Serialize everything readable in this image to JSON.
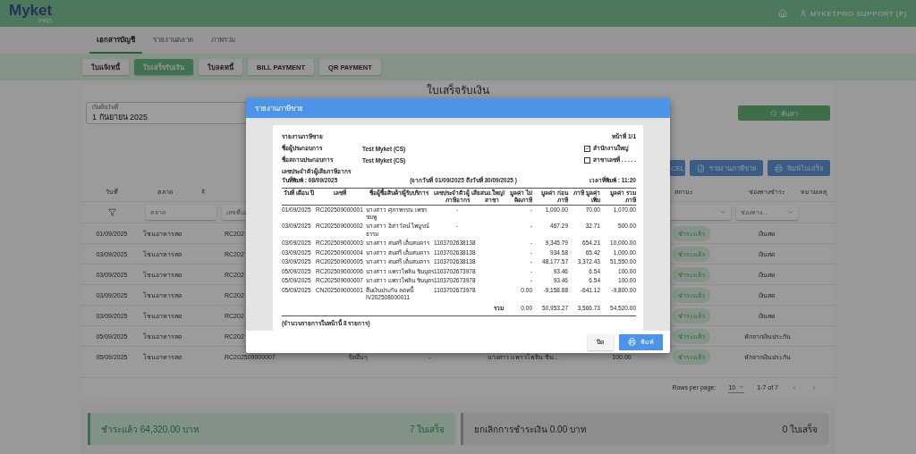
{
  "app": {
    "logo": "Myket",
    "logo_sub": "PRO",
    "user": "MYKETPRO SUPPORT (P)"
  },
  "tabs": [
    {
      "label": "เอกสารบัญชี",
      "selected": true
    },
    {
      "label": "รายงานตลาด",
      "selected": false
    },
    {
      "label": "ภาพรวม",
      "selected": false
    }
  ],
  "doc_types": [
    {
      "label": "ใบแจ้งหนี้",
      "selected": false
    },
    {
      "label": "ใบเสร็จรับเงิน",
      "selected": true
    },
    {
      "label": "ใบลดหนี้",
      "selected": false
    },
    {
      "label": "BILL PAYMENT",
      "selected": false
    },
    {
      "label": "QR PAYMENT",
      "selected": false
    }
  ],
  "page_title": "ใบเสร็จรับเงิน",
  "start_date": {
    "label": "เริ่มต้นวันที่",
    "value": "1 กันยายน 2025"
  },
  "search_button": "ค้นหา",
  "actions": [
    "CEL",
    "รายงานภาษีขาย",
    "พิมพ์ใบเสร็จ"
  ],
  "table": {
    "header": {
      "date": "วันที่",
      "market": "ตลาด",
      "status": "สถานะ",
      "payment": "ช่องทางชำระ",
      "note": "หมายเหตุ"
    },
    "filters": {
      "market": "ตลาด",
      "doc": "เลขที่เอ",
      "payment": "ช่องทาง..."
    },
    "rows": [
      {
        "date": "01/09/2025",
        "market": "โซนอาหารสด",
        "doc": "RC202",
        "status": "ชำระแล้ว",
        "payment": "เงินสด"
      },
      {
        "date": "03/09/2025",
        "market": "โซนอาหารสด",
        "doc": "RC202",
        "status": "ชำระแล้ว",
        "payment": "เงินสด"
      },
      {
        "date": "03/09/2025",
        "market": "โซนอาหารสด",
        "doc": "RC202",
        "status": "ชำระแล้ว",
        "payment": "เงินสด"
      },
      {
        "date": "03/09/2025",
        "market": "โซนอาหารสด",
        "doc": "RC202",
        "status": "ชำระแล้ว",
        "payment": "เงินสด"
      },
      {
        "date": "03/09/2025",
        "market": "โซนอาหารสด",
        "doc": "RC202",
        "status": "ชำระแล้ว",
        "payment": "เงินสด"
      },
      {
        "date": "05/09/2025",
        "market": "โซนอาหารสด",
        "doc": "RC202",
        "status": "ชำระแล้ว",
        "payment": "หักจากเงินประกัน"
      },
      {
        "date": "05/09/2025",
        "market": "โซนอาหารสด",
        "doc": "RC202509000007",
        "type": "บิลอื่นๆ",
        "ref": "-",
        "customer": "นางสาว แพรวไพลิน ชิน...",
        "amount": "100.00",
        "status": "ชำระแล้ว",
        "payment": "หักจากเงินประกัน"
      }
    ],
    "pagination": {
      "label": "Rows per page:",
      "per_page": "10",
      "range": "1-7 of 7"
    }
  },
  "summary": [
    {
      "kind": "paid",
      "label": "ชำระแล้ว 64,320.00 บาท",
      "count": "7 ใบเสร็จ"
    },
    {
      "kind": "cancelled",
      "label": "ยกเลิกการชำระเงิน 0.00 บาท",
      "count": "0 ใบเสร็จ"
    }
  ],
  "modal": {
    "title": "รายงานภาษีขาย",
    "close_button": "ปิด",
    "print_button": "พิมพ์",
    "report": {
      "title": "รายงานภาษีขาย",
      "page": "หน้าที่ 1/1",
      "info": [
        {
          "label": "ชื่อผู้ประกอบการ",
          "value": "Test Myket (CS)"
        },
        {
          "label": "ชื่อสถานประกอบการ",
          "value": "Test Myket (CS)"
        }
      ],
      "branch_options": [
        {
          "label": "สำนักงานใหญ่",
          "checked": true
        },
        {
          "label": "สาขาเลขที่ . . . . .",
          "checked": false
        }
      ],
      "tax_id_label": "เลขประจำตัวผู้เสียภาษีอากร",
      "print_date": "วันที่พิมพ์ : 08/09/2025",
      "range": "(จากวันที่ 01/09/2025 ถึงวันที่ 30/09/2025 )",
      "print_time": "เวลาที่พิมพ์ : 11:20",
      "columns": [
        "วันที่ เดือน ปี",
        "เลขที่",
        "ชื่อผู้ซื้อสินค้า/ผู้รับบริการ",
        "เลขประจำตัวผู้ เสียภาษีอากร",
        "สนง.ใหญ่/ สาขา",
        "มูลค่า ไม่คิดภาษี",
        "มูลค่า ก่อนภาษี",
        "ภาษี มูลค่าเพิ่ม",
        "มูลค่า รวมภาษี"
      ],
      "rows": [
        {
          "date": "01/09/2025",
          "no": "RC202509000001",
          "name": "นางสาว ศุภาพรรณ เพชร ชมพู",
          "tax_id": "-",
          "nonvat": "-",
          "base": "1,000.00",
          "vat": "70.00",
          "total": "1,070.00"
        },
        {
          "date": "03/09/2025",
          "no": "RC202509000002",
          "name": "นางสาว อิสาวัตน์ ไพบูรณ์ ธรรม",
          "tax_id": "-",
          "nonvat": "-",
          "base": "467.29",
          "vat": "32.71",
          "total": "500.00"
        },
        {
          "date": "03/09/2025",
          "no": "RC202509000003",
          "name": "นางสาว สมศรี เต็มสมคาร",
          "tax_id": "1103702638138",
          "nonvat": "-",
          "base": "9,345.79",
          "vat": "654.21",
          "total": "10,000.00"
        },
        {
          "date": "03/09/2025",
          "no": "RC202509000004",
          "name": "นางสาว สมศรี เต็มสมคาร",
          "tax_id": "1103702638138",
          "nonvat": "-",
          "base": "934.58",
          "vat": "65.42",
          "total": "1,000.00"
        },
        {
          "date": "03/09/2025",
          "no": "RC202509000005",
          "name": "นางสาว สมศรี เต็มสมคาร",
          "tax_id": "1103702638138",
          "nonvat": "-",
          "base": "48,177.57",
          "vat": "3,372.43",
          "total": "51,550.00"
        },
        {
          "date": "05/09/2025",
          "no": "RC202509000006",
          "name": "นางสาว แพรวไพลิน ชินบุตร",
          "tax_id": "1103702673978",
          "nonvat": "-",
          "base": "93.46",
          "vat": "6.54",
          "total": "100.00"
        },
        {
          "date": "05/09/2025",
          "no": "RC202509000007",
          "name": "นางสาว แพรวไพลิน ชินบุตร",
          "tax_id": "1103702673978",
          "nonvat": "-",
          "base": "93.46",
          "vat": "6.54",
          "total": "100.00"
        },
        {
          "date": "05/09/2025",
          "no": "CN202509000001",
          "name": "คืนเงินประกัน ลดหนี้ IV202508000011",
          "tax_id": "1103702673978",
          "nonvat": "0.00",
          "base": "-9,158.88",
          "vat": "-641.12",
          "total": "-9,800.00"
        }
      ],
      "total": {
        "label": "รวม",
        "nonvat": "0.00",
        "base": "50,953.27",
        "vat": "3,566.73",
        "total": "54,520.00"
      },
      "footer": "(จำนวนรายการในหน้านี้ 8 รายการ)"
    }
  }
}
